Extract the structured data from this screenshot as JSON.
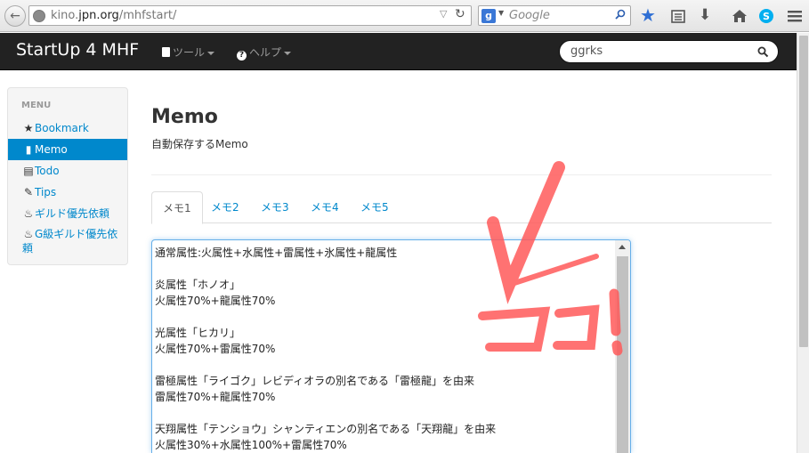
{
  "browser": {
    "url_host_prefix": "kino.",
    "url_host_domain": "jpn.org",
    "url_path": "/mhfstart/",
    "search_engine_placeholder": "Google",
    "search_engine_badge": "g"
  },
  "navbar": {
    "brand": "StartUp 4 MHF",
    "tools_label": "ツール",
    "help_label": "ヘルプ",
    "search_value": "ggrks"
  },
  "sidebar": {
    "header": "MENU",
    "items": [
      {
        "label": "Bookmark",
        "icon": "star-icon"
      },
      {
        "label": "Memo",
        "icon": "file-icon",
        "active": true
      },
      {
        "label": "Todo",
        "icon": "list-icon"
      },
      {
        "label": "Tips",
        "icon": "pencil-icon"
      },
      {
        "label": "ギルド優先依頼",
        "icon": "fire-icon"
      },
      {
        "label": "G級ギルド優先依頼",
        "icon": "fire-icon"
      }
    ]
  },
  "main": {
    "title": "Memo",
    "subtitle": "自動保存するMemo",
    "tabs": [
      "メモ1",
      "メモ2",
      "メモ3",
      "メモ4",
      "メモ5"
    ],
    "active_tab": "メモ1",
    "memo_lines": [
      "通常属性:火属性+水属性+雷属性+氷属性+龍属性",
      "",
      "炎属性「ホノオ」",
      "火属性70%+龍属性70%",
      "",
      "光属性「ヒカリ」",
      "火属性70%+雷属性70%",
      "",
      "雷極属性「ライゴク」レビディオラの別名である「雷極龍」を由来",
      "雷属性70%+龍属性70%",
      "",
      "天翔属性「テンショウ」シャンティエンの別名である「天翔龍」を由来",
      "火属性30%+水属性100%+雷属性70%"
    ]
  },
  "colors": {
    "link": "#0088cc",
    "navbar_bg": "#222222",
    "annotation": "#ff5a5a"
  }
}
